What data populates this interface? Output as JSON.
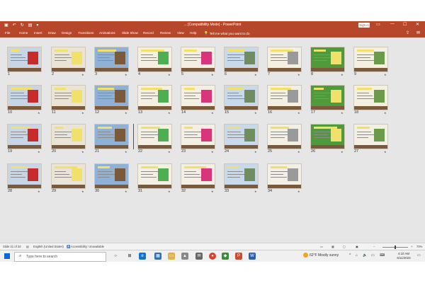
{
  "window": {
    "title": "... [Compatibility Mode] - PowerPoint",
    "sign_in": "Sign in"
  },
  "quick_access": [
    "save-icon",
    "undo-icon",
    "redo-icon",
    "start-from-beginning-icon",
    "customize-icon"
  ],
  "window_controls": {
    "ribbon_display": "▭",
    "minimize": "—",
    "maximize": "☐",
    "close": "✕"
  },
  "ribbon": {
    "tabs": [
      "File",
      "Home",
      "Insert",
      "Draw",
      "Design",
      "Transitions",
      "Animations",
      "Slide Show",
      "Record",
      "Review",
      "View",
      "Help"
    ],
    "tell_me": "Tell me what you want to do",
    "share_icon": "share-icon",
    "comments_icon": "comments-icon"
  },
  "slides": [
    {
      "n": "1"
    },
    {
      "n": "2"
    },
    {
      "n": "3"
    },
    {
      "n": "4"
    },
    {
      "n": "5"
    },
    {
      "n": "6"
    },
    {
      "n": "7"
    },
    {
      "n": "8"
    },
    {
      "n": "9"
    },
    {
      "n": "10"
    },
    {
      "n": "11"
    },
    {
      "n": "12"
    },
    {
      "n": "13"
    },
    {
      "n": "14"
    },
    {
      "n": "15"
    },
    {
      "n": "16"
    },
    {
      "n": "17"
    },
    {
      "n": "18"
    },
    {
      "n": "19"
    },
    {
      "n": "20"
    },
    {
      "n": "21"
    },
    {
      "n": "22"
    },
    {
      "n": "23"
    },
    {
      "n": "24"
    },
    {
      "n": "25"
    },
    {
      "n": "26"
    },
    {
      "n": "27"
    },
    {
      "n": "28"
    },
    {
      "n": "29"
    },
    {
      "n": "30"
    },
    {
      "n": "31"
    },
    {
      "n": "32"
    },
    {
      "n": "33"
    },
    {
      "n": "34"
    }
  ],
  "status_bar": {
    "slide_count": "Slide 21 of 34",
    "language": "English (United States)",
    "accessibility": "Accessibility: Unavailable",
    "zoom": "70%"
  },
  "taskbar": {
    "search_placeholder": "Type here to search",
    "weather": "62°F  Mostly sunny",
    "time": "4:10 AM",
    "date": "6/11/2023"
  }
}
